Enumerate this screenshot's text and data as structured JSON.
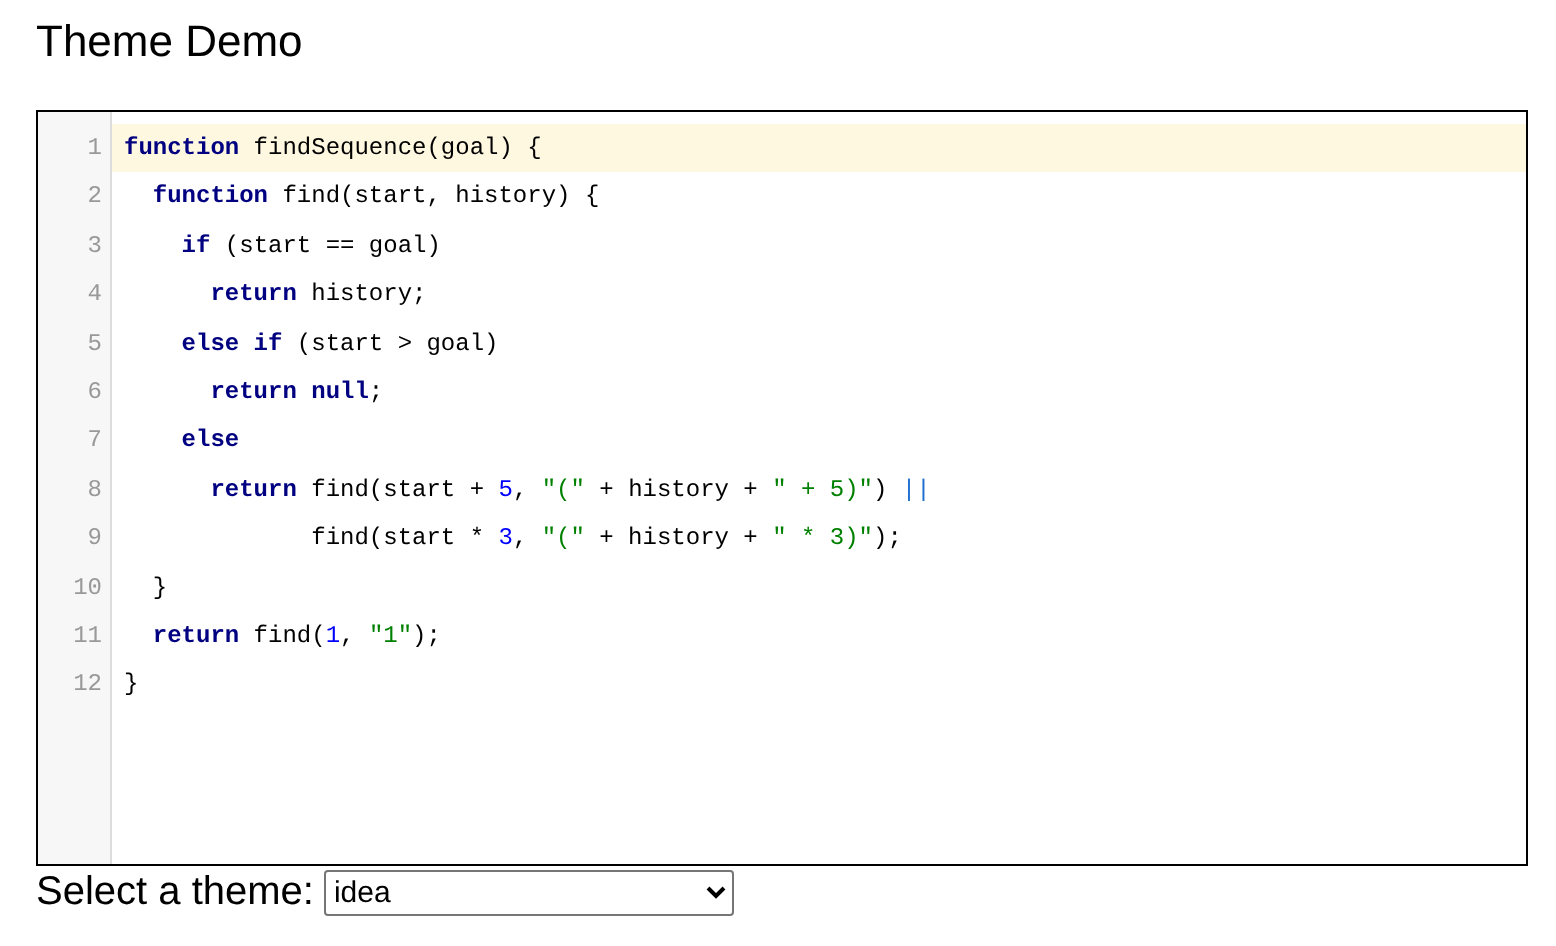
{
  "title": "Theme Demo",
  "editor": {
    "lines": [
      {
        "number": "1",
        "active": true,
        "tokens": [
          {
            "kind": "keyword",
            "text": "function"
          },
          {
            "kind": "plain",
            "text": " findSequence(goal) {"
          }
        ]
      },
      {
        "number": "2",
        "active": false,
        "tokens": [
          {
            "kind": "keyword",
            "text": "  function"
          },
          {
            "kind": "plain",
            "text": " find(start, history) {"
          }
        ]
      },
      {
        "number": "3",
        "active": false,
        "tokens": [
          {
            "kind": "keyword",
            "text": "    if"
          },
          {
            "kind": "plain",
            "text": " (start == goal)"
          }
        ]
      },
      {
        "number": "4",
        "active": false,
        "tokens": [
          {
            "kind": "keyword",
            "text": "      return"
          },
          {
            "kind": "plain",
            "text": " history;"
          }
        ]
      },
      {
        "number": "5",
        "active": false,
        "tokens": [
          {
            "kind": "keyword",
            "text": "    else if"
          },
          {
            "kind": "plain",
            "text": " (start > goal)"
          }
        ]
      },
      {
        "number": "6",
        "active": false,
        "tokens": [
          {
            "kind": "keyword",
            "text": "      return null"
          },
          {
            "kind": "plain",
            "text": ";"
          }
        ]
      },
      {
        "number": "7",
        "active": false,
        "tokens": [
          {
            "kind": "keyword",
            "text": "    else"
          }
        ]
      },
      {
        "number": "8",
        "active": false,
        "tokens": [
          {
            "kind": "keyword",
            "text": "      return"
          },
          {
            "kind": "plain",
            "text": " find(start + "
          },
          {
            "kind": "number",
            "text": "5"
          },
          {
            "kind": "plain",
            "text": ", "
          },
          {
            "kind": "string",
            "text": "\"(\""
          },
          {
            "kind": "plain",
            "text": " + history + "
          },
          {
            "kind": "string",
            "text": "\" + 5)\""
          },
          {
            "kind": "plain",
            "text": ") "
          },
          {
            "kind": "operator",
            "text": "||"
          }
        ]
      },
      {
        "number": "9",
        "active": false,
        "tokens": [
          {
            "kind": "plain",
            "text": "             find(start * "
          },
          {
            "kind": "number",
            "text": "3"
          },
          {
            "kind": "plain",
            "text": ", "
          },
          {
            "kind": "string",
            "text": "\"(\""
          },
          {
            "kind": "plain",
            "text": " + history + "
          },
          {
            "kind": "string",
            "text": "\" * 3)\""
          },
          {
            "kind": "plain",
            "text": ");"
          }
        ]
      },
      {
        "number": "10",
        "active": false,
        "tokens": [
          {
            "kind": "plain",
            "text": "  }"
          }
        ]
      },
      {
        "number": "11",
        "active": false,
        "tokens": [
          {
            "kind": "keyword",
            "text": "  return"
          },
          {
            "kind": "plain",
            "text": " find("
          },
          {
            "kind": "number",
            "text": "1"
          },
          {
            "kind": "plain",
            "text": ", "
          },
          {
            "kind": "string",
            "text": "\"1\""
          },
          {
            "kind": "plain",
            "text": ");"
          }
        ]
      },
      {
        "number": "12",
        "active": false,
        "tokens": [
          {
            "kind": "plain",
            "text": "}"
          }
        ]
      }
    ]
  },
  "theme_picker": {
    "label": "Select a theme:",
    "value": "idea"
  }
}
